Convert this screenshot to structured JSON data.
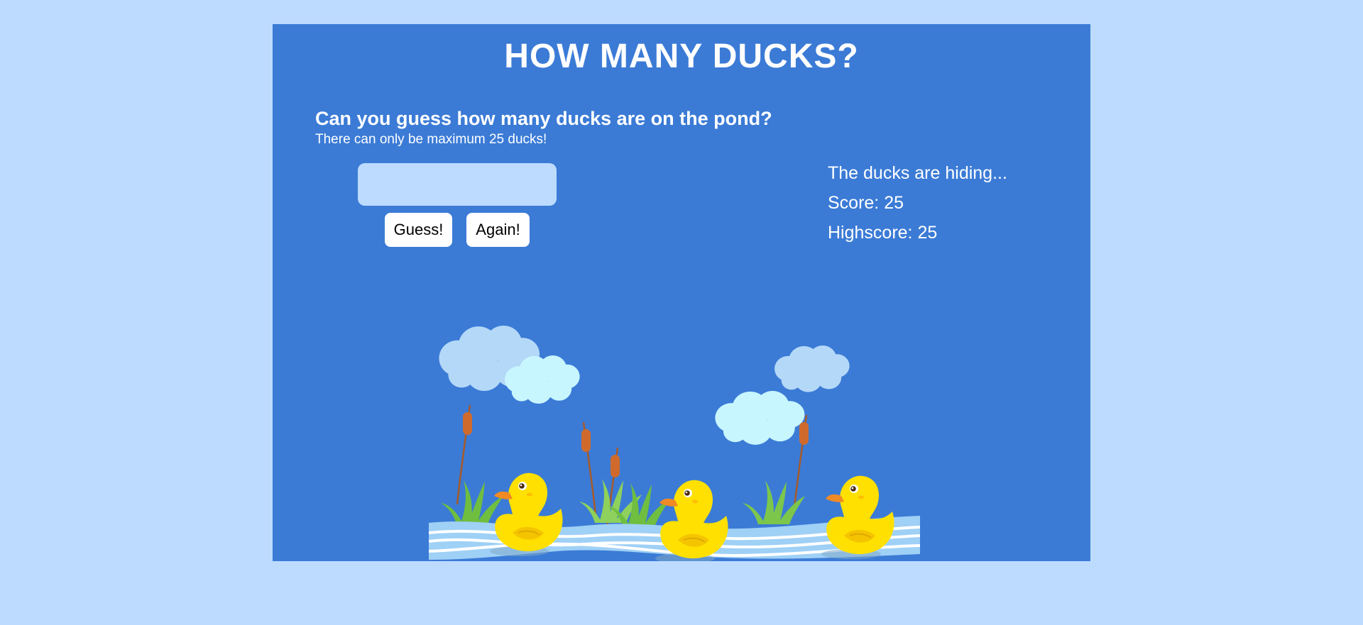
{
  "game": {
    "title": "HOW MANY DUCKS?",
    "prompt_heading": "Can you guess how many ducks are on the pond?",
    "prompt_sub": "There can only be maximum 25 ducks!",
    "guess_input": {
      "value": "",
      "placeholder": ""
    },
    "guess_button_label": "Guess!",
    "again_button_label": "Again!",
    "status_text": "The ducks are hiding...",
    "score_label": "Score:",
    "score_value": "25",
    "highscore_label": "Highscore:",
    "highscore_value": "25"
  },
  "colors": {
    "page_background": "#bddbff",
    "panel_background": "#3b7bd6",
    "input_background": "#bddbff",
    "button_background": "#ffffff",
    "text": "#ffffff",
    "duck_body": "#ffe000",
    "duck_beak": "#f08a24",
    "water": "#9fd0f6",
    "water_stripes": "#ffffff",
    "cloud_light": "#c8f6ff",
    "cloud_blue": "#b4d8f7",
    "cattail": "#d06a2c",
    "grass": "#6fbe3f"
  }
}
